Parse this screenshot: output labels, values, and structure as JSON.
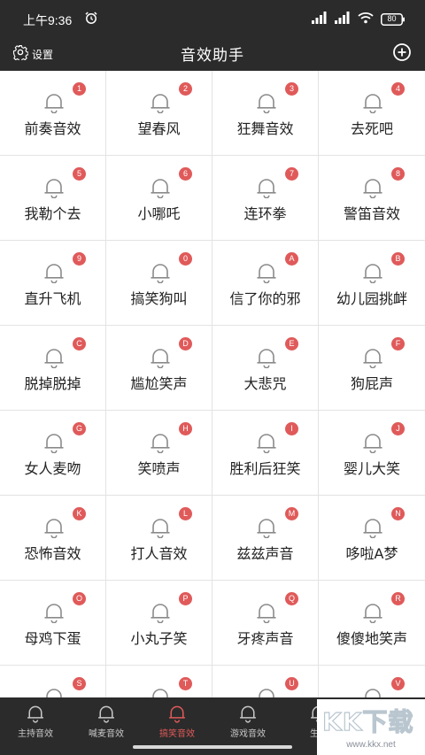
{
  "status_bar": {
    "time": "上午9:36",
    "battery": "80",
    "icons": [
      "alarm-icon",
      "signal-icon",
      "signal-icon",
      "wifi-icon",
      "battery-icon"
    ]
  },
  "header": {
    "settings_label": "设置",
    "title": "音效助手",
    "settings_icon": "gear-icon",
    "add_icon": "plus-circle-icon"
  },
  "sounds": [
    {
      "badge": "1",
      "label": "前奏音效"
    },
    {
      "badge": "2",
      "label": "望春风"
    },
    {
      "badge": "3",
      "label": "狂舞音效"
    },
    {
      "badge": "4",
      "label": "去死吧"
    },
    {
      "badge": "5",
      "label": "我勒个去"
    },
    {
      "badge": "6",
      "label": "小哪吒"
    },
    {
      "badge": "7",
      "label": "连环拳"
    },
    {
      "badge": "8",
      "label": "警笛音效"
    },
    {
      "badge": "9",
      "label": "直升飞机"
    },
    {
      "badge": "0",
      "label": "搞笑狗叫"
    },
    {
      "badge": "A",
      "label": "信了你的邪"
    },
    {
      "badge": "B",
      "label": "幼儿园挑衅"
    },
    {
      "badge": "C",
      "label": "脱掉脱掉"
    },
    {
      "badge": "D",
      "label": "尴尬笑声"
    },
    {
      "badge": "E",
      "label": "大悲咒"
    },
    {
      "badge": "F",
      "label": "狗屁声"
    },
    {
      "badge": "G",
      "label": "女人麦吻"
    },
    {
      "badge": "H",
      "label": "笑喷声"
    },
    {
      "badge": "I",
      "label": "胜利后狂笑"
    },
    {
      "badge": "J",
      "label": "婴儿大笑"
    },
    {
      "badge": "K",
      "label": "恐怖音效"
    },
    {
      "badge": "L",
      "label": "打人音效"
    },
    {
      "badge": "M",
      "label": "兹兹声音"
    },
    {
      "badge": "N",
      "label": "哆啦A梦"
    },
    {
      "badge": "O",
      "label": "母鸡下蛋"
    },
    {
      "badge": "P",
      "label": "小丸子笑"
    },
    {
      "badge": "Q",
      "label": "牙疼声音"
    },
    {
      "badge": "R",
      "label": "傻傻地笑声"
    },
    {
      "badge": "S",
      "label": ""
    },
    {
      "badge": "T",
      "label": ""
    },
    {
      "badge": "U",
      "label": ""
    },
    {
      "badge": "V",
      "label": ""
    }
  ],
  "bottom_tabs": [
    {
      "label": "主持音效",
      "active": false
    },
    {
      "label": "喊麦音效",
      "active": false
    },
    {
      "label": "搞笑音效",
      "active": true
    },
    {
      "label": "游戏音效",
      "active": false
    },
    {
      "label": "生活",
      "active": false
    }
  ],
  "watermark": {
    "logo_text": "KK下载",
    "url": "www.kkx.net"
  },
  "colors": {
    "bar_background": "#2b2b2b",
    "badge": "#e05a5a",
    "active_tab": "#e05a5a",
    "inactive_tab": "#c7c7c7",
    "grid_line": "#e3e3e3"
  }
}
